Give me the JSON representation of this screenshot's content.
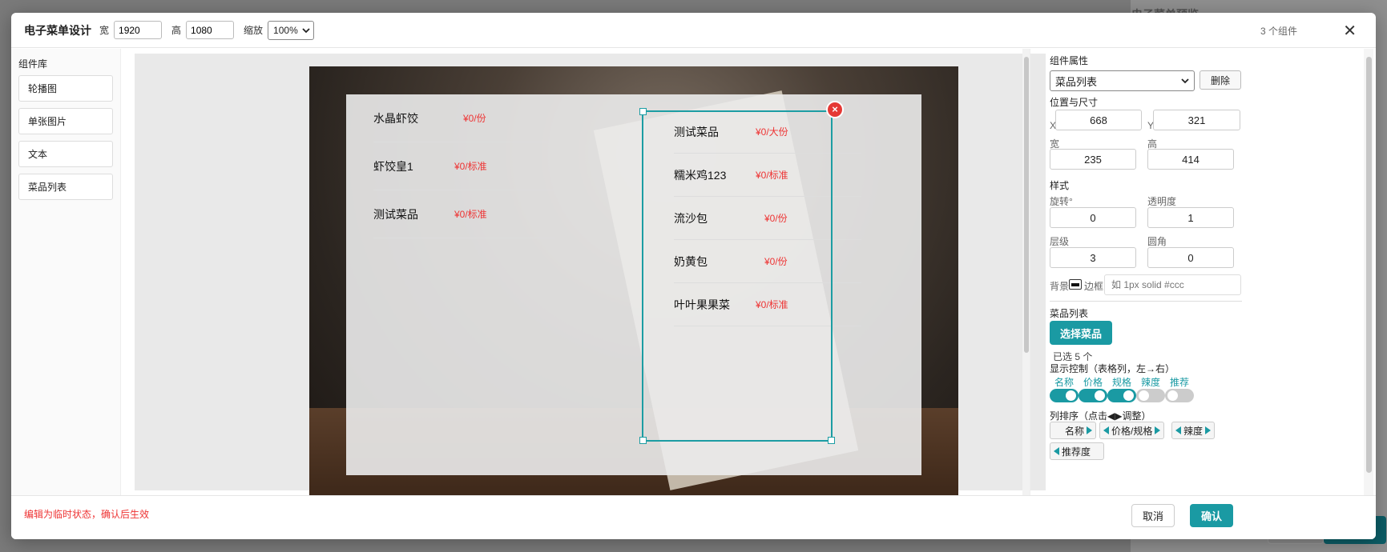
{
  "background": {
    "title": "电子菜单预览"
  },
  "topbar": {
    "title": "电子菜单设计",
    "width_label": "宽",
    "width_value": "1920",
    "height_label": "高",
    "height_value": "1080",
    "zoom_label": "缩放",
    "zoom_value": "100%",
    "count": "3 个组件"
  },
  "library": {
    "title": "组件库",
    "items": [
      "轮播图",
      "单张图片",
      "文本",
      "菜品列表"
    ]
  },
  "canvas": {
    "list_a": [
      {
        "name": "水晶虾饺",
        "price": "¥0/份"
      },
      {
        "name": "虾饺皇1",
        "price": "¥0/标准"
      },
      {
        "name": "测试菜品",
        "price": "¥0/标准"
      }
    ],
    "list_b": [
      {
        "name": "测试菜品",
        "price": "¥0/大份"
      },
      {
        "name": "糯米鸡123",
        "price": "¥0/标准"
      },
      {
        "name": "流沙包",
        "price": "¥0/份"
      },
      {
        "name": "奶黄包",
        "price": "¥0/份"
      },
      {
        "name": "叶叶果果菜",
        "price": "¥0/标准"
      }
    ],
    "delete_glyph": "×"
  },
  "props": {
    "title": "组件属性",
    "component_select": "菜品列表",
    "delete_label": "删除",
    "pos_size_title": "位置与尺寸",
    "x_label": "X",
    "x_value": "668",
    "y_label": "Y",
    "y_value": "321",
    "w_label": "宽",
    "w_value": "235",
    "h_label": "高",
    "h_value": "414",
    "style_title": "样式",
    "rotate_label": "旋转°",
    "rotate_value": "0",
    "opacity_label": "透明度",
    "opacity_value": "1",
    "layer_label": "层级",
    "layer_value": "3",
    "radius_label": "圆角",
    "radius_value": "0",
    "bg_label": "背景",
    "border_label": "边框",
    "border_placeholder": "如 1px solid #ccc",
    "list_title": "菜品列表",
    "choose_label": "选择菜品",
    "selected_text": "已选 5 个",
    "display_title": "显示控制（表格列，左→右）",
    "toggles": [
      {
        "label": "名称",
        "on": true
      },
      {
        "label": "价格",
        "on": true
      },
      {
        "label": "规格",
        "on": true
      },
      {
        "label": "辣度",
        "on": false
      },
      {
        "label": "推荐",
        "on": false
      }
    ],
    "order_title": "列排序（点击◀▶调整）",
    "order_chips": [
      "名称",
      "价格/规格",
      "辣度",
      "推荐度"
    ]
  },
  "footer": {
    "hint": "编辑为临时状态，确认后生效",
    "cancel": "取消",
    "confirm": "确认"
  },
  "colors": {
    "accent": "#1a9aa3",
    "danger": "#e53935",
    "price": "#e33333"
  }
}
